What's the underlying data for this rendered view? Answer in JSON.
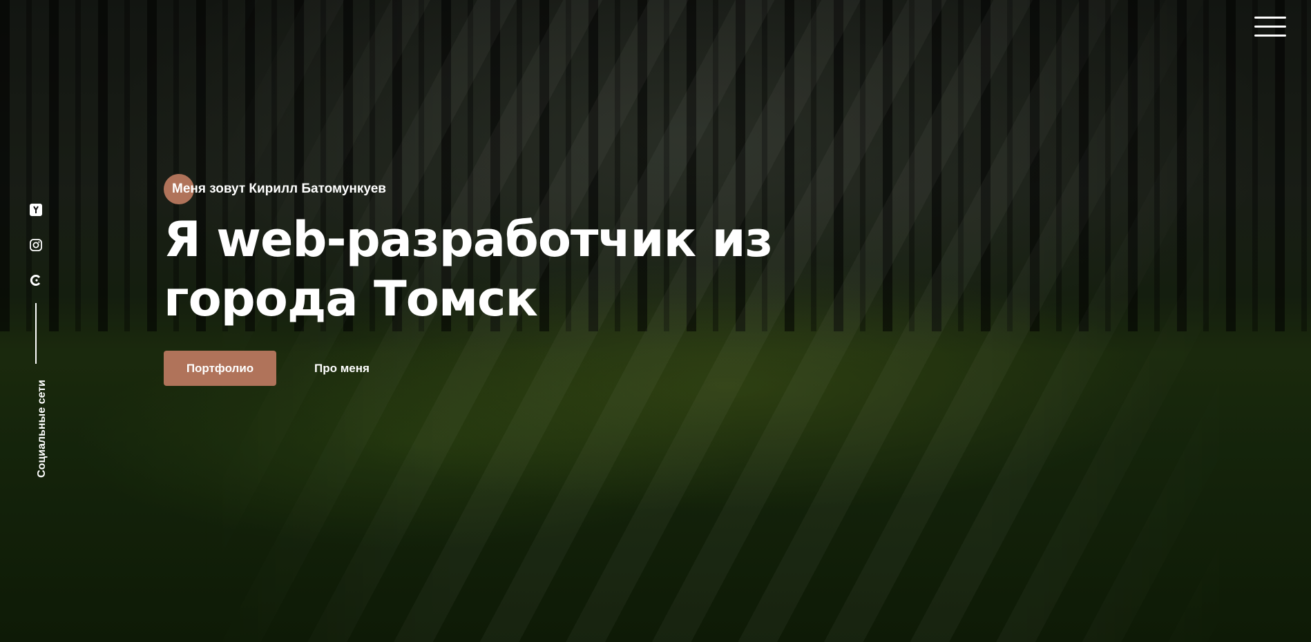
{
  "social": {
    "label": "Социальные сети",
    "links": [
      {
        "icon": "yandex-icon"
      },
      {
        "icon": "instagram-icon"
      },
      {
        "icon": "c-logo-icon"
      }
    ]
  },
  "menu": {
    "icon": "hamburger-menu-icon"
  },
  "hero": {
    "intro": "Меня зовут Кирилл Батомункуев",
    "headline_line1": "Я web-разработчик из",
    "headline_line2": "города Томск",
    "primary_button": "Портфолио",
    "secondary_button": "Про меня"
  },
  "colors": {
    "accent": "#b0735a",
    "text": "#ffffff"
  }
}
